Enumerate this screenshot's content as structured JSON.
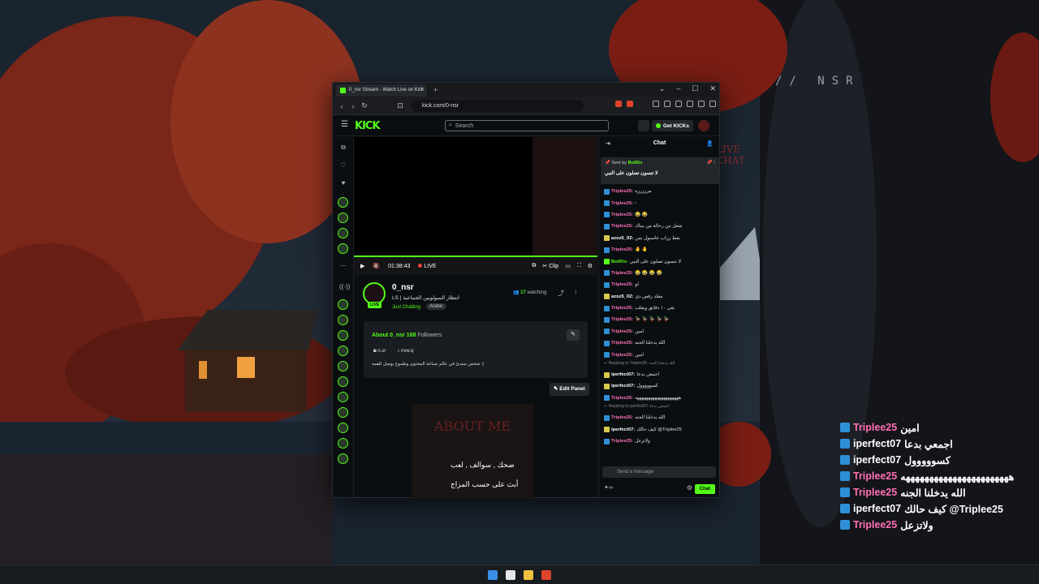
{
  "wallpaper": {
    "watermark": "// NSR"
  },
  "browser": {
    "tab_title": "0_nsr Stream - Watch Live on Kick",
    "url": "kick.com/0-nsr"
  },
  "kick": {
    "logo": "KICK",
    "search_placeholder": "Search",
    "get_kicks": "Get KICKs"
  },
  "player": {
    "overlay_text": "LIVE CHAT",
    "time": "01:38:43",
    "live": "LIVE",
    "clip": "Clip"
  },
  "channel": {
    "name": "0_nsr",
    "live_badge": "LIVE",
    "title": "LS | انتظار السولويين الجماعية",
    "category": "Just Chatting",
    "language": "Arabic",
    "viewers": "17",
    "watching_label": "watching"
  },
  "about": {
    "heading": "About 0_nsr",
    "followers": "168",
    "followers_label": "Followers",
    "discord": "n.sr",
    "tiktok": "nvw.q",
    "description": "شخص مبتدئ في عالم صناعة المحتوى وطموح يوصل للقمة :(",
    "edit_panel": "Edit Panel"
  },
  "panel": {
    "title": "ABOUT ME",
    "line1": "ضحك , سوالف , لعب",
    "line2": "أبث على حسب المزاج"
  },
  "chat": {
    "title": "Chat",
    "pinned": {
      "sent_by": "Sent by",
      "bot": "BotRix",
      "text": "لا تنسون تصلون على النبي"
    },
    "placeholder": "Send a message",
    "send": "Chat",
    "messages": [
      {
        "user": "Triplee25",
        "color": "#ff6fb5",
        "badge": "b",
        "text": "مررررره"
      },
      {
        "user": "Triplee25",
        "color": "#ff6fb5",
        "badge": "b",
        "text": "▫"
      },
      {
        "user": "Triplee25",
        "color": "#ff6fb5",
        "badge": "b",
        "text": "😂 😂"
      },
      {
        "user": "Triplee25",
        "color": "#ff6fb5",
        "badge": "b",
        "text": "شعل من رحالة من بيناك"
      },
      {
        "user": "azoz5_02",
        "color": "#ffffff",
        "badge": "y",
        "text": "بعط زراب عاسبول بس"
      },
      {
        "user": "Triplee25",
        "color": "#ff6fb5",
        "badge": "b",
        "text": "🤚 🤚"
      },
      {
        "user": "BotRix",
        "color": "#53fc18",
        "badge": "g",
        "text": "لا تنسون تصلون على النبي"
      },
      {
        "user": "Triplee25",
        "color": "#ff6fb5",
        "badge": "b",
        "text": "😂 😂 😂 😂"
      },
      {
        "user": "Triplee25",
        "color": "#ff6fb5",
        "badge": "b",
        "text": "لو"
      },
      {
        "user": "azoz5_02",
        "color": "#ffffff",
        "badge": "y",
        "text": "مقلد رقص دي"
      },
      {
        "user": "Triplee25",
        "color": "#ff6fb5",
        "badge": "b",
        "text": "بقي ١٠ دقايق ويقلب"
      },
      {
        "user": "Triplee25",
        "color": "#ff6fb5",
        "badge": "b",
        "text": "🦆 🦆 🦆 🦆 🦆"
      },
      {
        "user": "Triplee25",
        "color": "#ff6fb5",
        "badge": "b",
        "text": "امين"
      },
      {
        "user": "Triplee25",
        "color": "#ff6fb5",
        "badge": "b",
        "text": "الله يدخلنا الجنه"
      },
      {
        "user": "Triplee25",
        "color": "#ff6fb5",
        "badge": "b",
        "text": "امين"
      },
      {
        "reply": "Replying to Triplee25: الله يدخلنا الجنه"
      },
      {
        "user": "iperfect07",
        "color": "#ffffff",
        "badge": "y",
        "text": "اجمعي بدعا"
      },
      {
        "user": "iperfect07",
        "color": "#ffffff",
        "badge": "y",
        "text": "كسووووول"
      },
      {
        "user": "Triplee25",
        "color": "#ff6fb5",
        "badge": "b",
        "text": "ههههههههههههههههههههه"
      },
      {
        "reply": "Replying to iperfect07: اجمعي بدعا"
      },
      {
        "user": "Triplee25",
        "color": "#ff6fb5",
        "badge": "b",
        "text": "الله يدخلنا الجنه"
      },
      {
        "user": "iperfect07",
        "color": "#ffffff",
        "badge": "y",
        "text": "كيف حالك @Triplee25"
      },
      {
        "user": "Triplee25",
        "color": "#ff6fb5",
        "badge": "b",
        "text": "ولاتزعل"
      }
    ]
  },
  "overlay": [
    {
      "user": "Triplee25",
      "color": "#ff6fb5",
      "text": "امين"
    },
    {
      "user": "iperfect07",
      "color": "#ffffff",
      "text": "اجمعي بدعا"
    },
    {
      "user": "iperfect07",
      "color": "#ffffff",
      "text": "كسووووول"
    },
    {
      "user": "Triplee25",
      "color": "#ff6fb5",
      "text": "هههههههههههههههههههههههه"
    },
    {
      "user": "Triplee25",
      "color": "#ff6fb5",
      "text": "الله يدخلنا الجنه"
    },
    {
      "user": "iperfect07",
      "color": "#ffffff",
      "text": "كيف حالك @Triplee25"
    },
    {
      "user": "Triplee25",
      "color": "#ff6fb5",
      "text": "ولاتزعل"
    }
  ]
}
